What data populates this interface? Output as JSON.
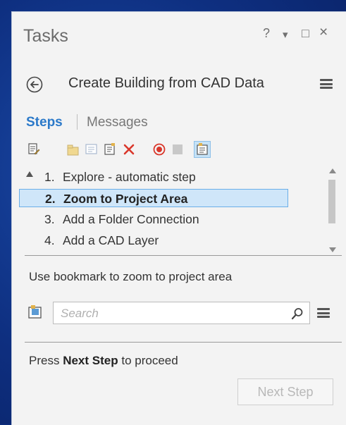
{
  "pane": {
    "title": "Tasks",
    "help_glyph": "?",
    "dropdown_glyph": "▾",
    "maximize_glyph": "□",
    "close_glyph": "×"
  },
  "header": {
    "task_name": "Create Building from CAD Data"
  },
  "tabs": {
    "steps": "Steps",
    "messages": "Messages"
  },
  "toolbar": {
    "icons": [
      "edit-task-icon",
      "new-group-icon",
      "new-step-icon",
      "step-properties-icon",
      "delete-icon",
      "record-icon",
      "stop-icon",
      "view-task-icon"
    ]
  },
  "steps": [
    {
      "num": "1.",
      "label": "Explore - automatic step",
      "selected": false
    },
    {
      "num": "2.",
      "label": "Zoom to Project Area",
      "selected": true
    },
    {
      "num": "3.",
      "label": "Add a Folder Connection",
      "selected": false
    },
    {
      "num": "4.",
      "label": "Add a CAD Layer",
      "selected": false
    }
  ],
  "instruction": "Use bookmark to zoom to project area",
  "search": {
    "placeholder": "Search"
  },
  "footer": {
    "proceed_prefix": "Press",
    "proceed_bold": "Next Step",
    "proceed_suffix": "to proceed",
    "next_button": "Next Step"
  },
  "colors": {
    "accent": "#2b79c9",
    "selection": "#cfe6f9",
    "delete": "#d9372b",
    "record": "#d9372b"
  }
}
